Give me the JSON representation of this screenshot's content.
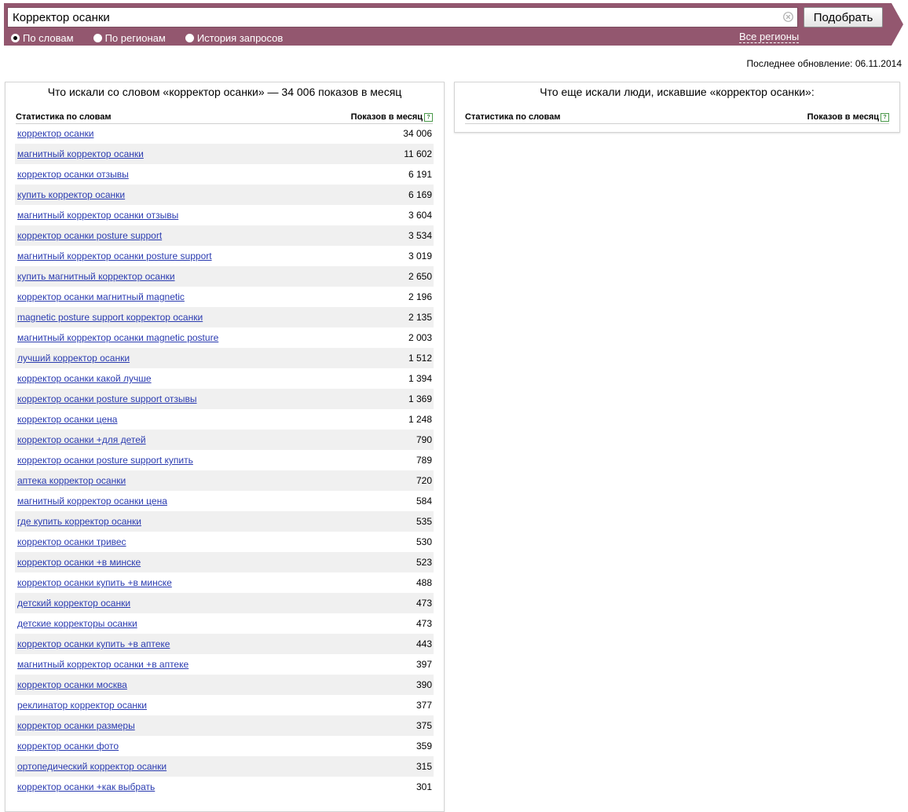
{
  "search": {
    "value": "Корректор осанки",
    "button_label": "Подобрать"
  },
  "modes": [
    {
      "label": "По словам",
      "checked": true
    },
    {
      "label": "По регионам",
      "checked": false
    },
    {
      "label": "История запросов",
      "checked": false
    }
  ],
  "regions_link": "Все регионы",
  "last_update": "Последнее обновление: 06.11.2014",
  "left_panel": {
    "title": "Что искали со словом «корректор осанки» — 34 006 показов в месяц",
    "col_words": "Статистика по словам",
    "col_shows": "Показов в месяц",
    "help_glyph": "?",
    "rows": [
      {
        "phrase": "корректор осанки",
        "count": "34 006"
      },
      {
        "phrase": "магнитный корректор осанки",
        "count": "11 602"
      },
      {
        "phrase": "корректор осанки отзывы",
        "count": "6 191"
      },
      {
        "phrase": "купить корректор осанки",
        "count": "6 169"
      },
      {
        "phrase": "магнитный корректор осанки отзывы",
        "count": "3 604"
      },
      {
        "phrase": "корректор осанки posture support",
        "count": "3 534"
      },
      {
        "phrase": "магнитный корректор осанки posture support",
        "count": "3 019"
      },
      {
        "phrase": "купить магнитный корректор осанки",
        "count": "2 650"
      },
      {
        "phrase": "корректор осанки магнитный magnetic",
        "count": "2 196"
      },
      {
        "phrase": "magnetic posture support корректор осанки",
        "count": "2 135"
      },
      {
        "phrase": "магнитный корректор осанки magnetic posture",
        "count": "2 003"
      },
      {
        "phrase": "лучший корректор осанки",
        "count": "1 512"
      },
      {
        "phrase": "корректор осанки какой лучше",
        "count": "1 394"
      },
      {
        "phrase": "корректор осанки posture support отзывы",
        "count": "1 369"
      },
      {
        "phrase": "корректор осанки цена",
        "count": "1 248"
      },
      {
        "phrase": "корректор осанки +для детей",
        "count": "790"
      },
      {
        "phrase": "корректор осанки posture support купить",
        "count": "789"
      },
      {
        "phrase": "аптека корректор осанки",
        "count": "720"
      },
      {
        "phrase": "магнитный корректор осанки цена",
        "count": "584"
      },
      {
        "phrase": "где купить корректор осанки",
        "count": "535"
      },
      {
        "phrase": "корректор осанки тривес",
        "count": "530"
      },
      {
        "phrase": "корректор осанки +в минске",
        "count": "523"
      },
      {
        "phrase": "корректор осанки купить +в минске",
        "count": "488"
      },
      {
        "phrase": "детский корректор осанки",
        "count": "473"
      },
      {
        "phrase": "детские корректоры осанки",
        "count": "473"
      },
      {
        "phrase": "корректор осанки купить +в аптеке",
        "count": "443"
      },
      {
        "phrase": "магнитный корректор осанки +в аптеке",
        "count": "397"
      },
      {
        "phrase": "корректор осанки москва",
        "count": "390"
      },
      {
        "phrase": "реклинатор корректор осанки",
        "count": "377"
      },
      {
        "phrase": "корректор осанки размеры",
        "count": "375"
      },
      {
        "phrase": "корректор осанки фото",
        "count": "359"
      },
      {
        "phrase": "ортопедический корректор осанки",
        "count": "315"
      },
      {
        "phrase": "корректор осанки +как выбрать",
        "count": "301"
      }
    ]
  },
  "right_panel": {
    "title": "Что еще искали люди, искавшие «корректор осанки»:",
    "col_words": "Статистика по словам",
    "col_shows": "Показов в месяц",
    "help_glyph": "?"
  },
  "colors": {
    "header": "#93576f",
    "link": "#2a3bb0",
    "row_alt": "#f0f0f0"
  },
  "icons": [
    "clear-icon",
    "help-icon"
  ]
}
